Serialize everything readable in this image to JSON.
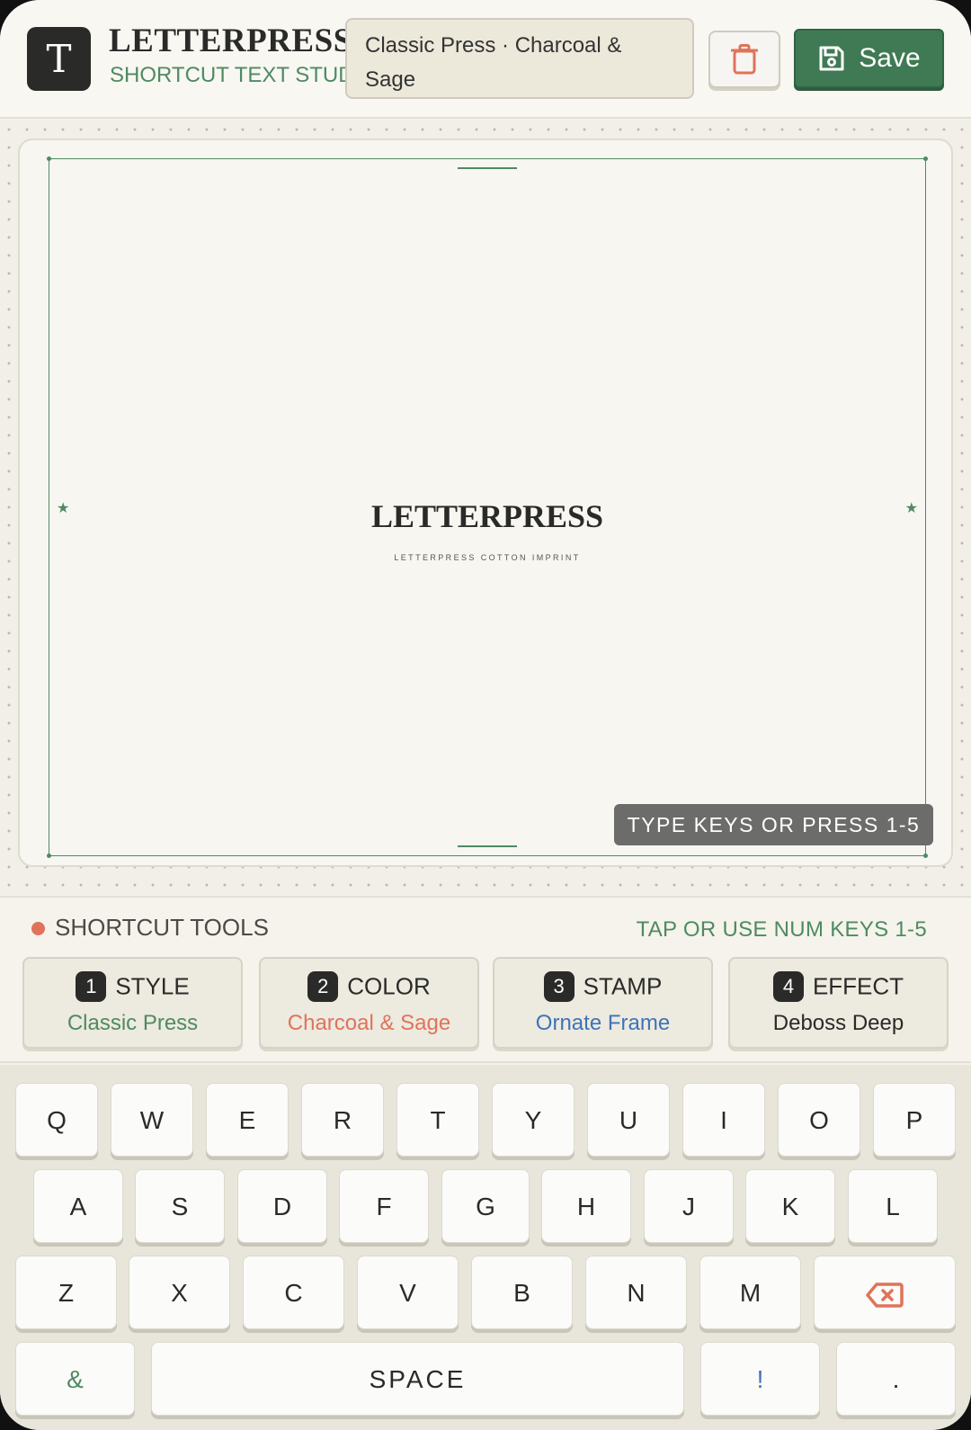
{
  "header": {
    "logo_letter": "T",
    "brand_title": "LETTERPRESS",
    "brand_subtitle": "SHORTCUT TEXT STUDIO",
    "preset_label": "Classic Press · Charcoal & Sage",
    "save_label": "Save"
  },
  "canvas": {
    "title": "LETTERPRESS",
    "subtitle": "LETTERPRESS COTTON IMPRINT",
    "hint": "TYPE KEYS OR PRESS 1-5"
  },
  "tools": {
    "title": "SHORTCUT TOOLS",
    "hint": "TAP OR USE NUM KEYS 1-5",
    "items": [
      {
        "num": "1",
        "label": "STYLE",
        "value": "Classic Press",
        "color": "#4f8a62"
      },
      {
        "num": "2",
        "label": "COLOR",
        "value": "Charcoal & Sage",
        "color": "#e0735a"
      },
      {
        "num": "3",
        "label": "STAMP",
        "value": "Ornate Frame",
        "color": "#3f73b8"
      },
      {
        "num": "4",
        "label": "EFFECT",
        "value": "Deboss Deep",
        "color": "#2a2a28"
      }
    ]
  },
  "keyboard": {
    "row1": [
      "Q",
      "W",
      "E",
      "R",
      "T",
      "Y",
      "U",
      "I",
      "O",
      "P"
    ],
    "row2": [
      "A",
      "S",
      "D",
      "F",
      "G",
      "H",
      "J",
      "K",
      "L"
    ],
    "row3": [
      "Z",
      "X",
      "C",
      "V",
      "B",
      "N",
      "M"
    ],
    "row4": {
      "amp": "&",
      "space": "SPACE",
      "excl": "!",
      "period": "."
    }
  },
  "colors": {
    "accent_green": "#4f8a62",
    "save_green": "#3f7a54",
    "coral": "#e0735a",
    "blue": "#3f73b8",
    "ink": "#2a2a28"
  }
}
